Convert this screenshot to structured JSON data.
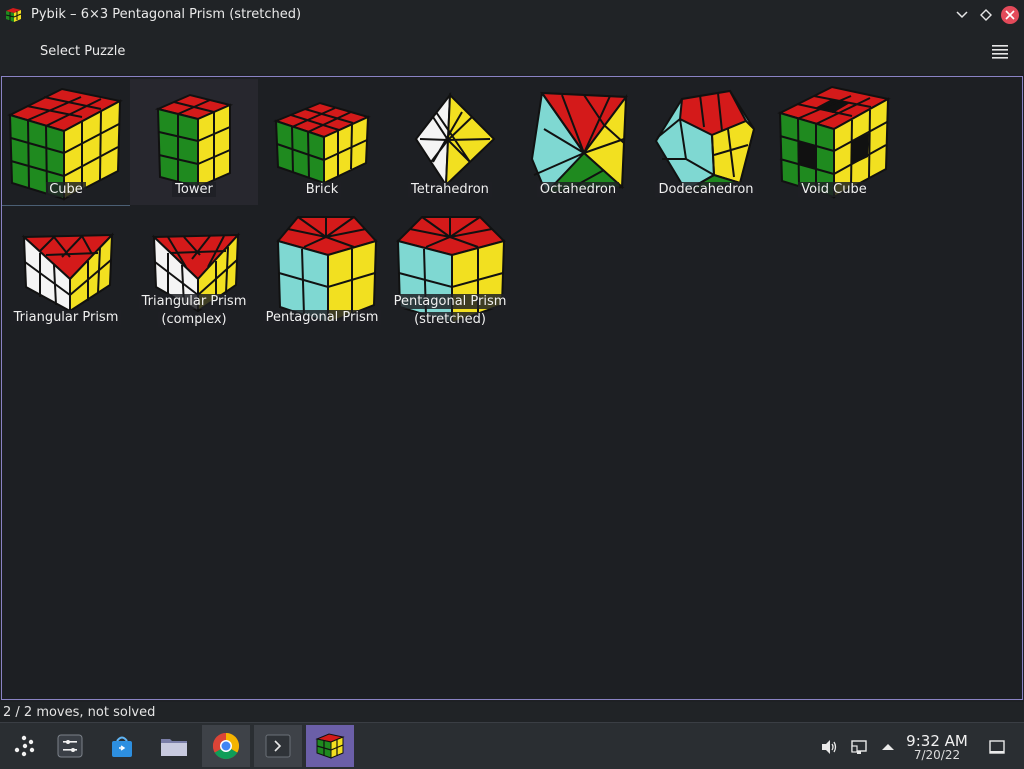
{
  "window": {
    "title": "Pybik – 6×3 Pentagonal Prism (stretched)"
  },
  "header": {
    "title": "Select Puzzle"
  },
  "puzzles": [
    {
      "label1": "Cube",
      "label2": ""
    },
    {
      "label1": "Tower",
      "label2": ""
    },
    {
      "label1": "Brick",
      "label2": ""
    },
    {
      "label1": "Tetrahedron",
      "label2": ""
    },
    {
      "label1": "Octahedron",
      "label2": ""
    },
    {
      "label1": "Dodecahedron",
      "label2": ""
    },
    {
      "label1": "Void Cube",
      "label2": ""
    },
    {
      "label1": "Triangular Prism",
      "label2": ""
    },
    {
      "label1": "Triangular Prism",
      "label2": "(complex)"
    },
    {
      "label1": "Pentagonal Prism",
      "label2": ""
    },
    {
      "label1": "Pentagonal Prism",
      "label2": "(stretched)"
    }
  ],
  "status": {
    "text": "2 / 2 moves, not solved"
  },
  "taskbar": {
    "apps": [
      "app-launcher-icon",
      "system-settings-icon",
      "discover-store-icon",
      "file-manager-icon",
      "chrome-icon",
      "terminal-icon",
      "pybik-icon"
    ],
    "time": "9:32 AM",
    "date": "7/20/22"
  },
  "colors": {
    "red": "#d41a1a",
    "green": "#1f8a1f",
    "yellow": "#f2e020",
    "white": "#f4f4f4",
    "cyan": "#7fd8d2",
    "accent": "#6b5fa8"
  }
}
